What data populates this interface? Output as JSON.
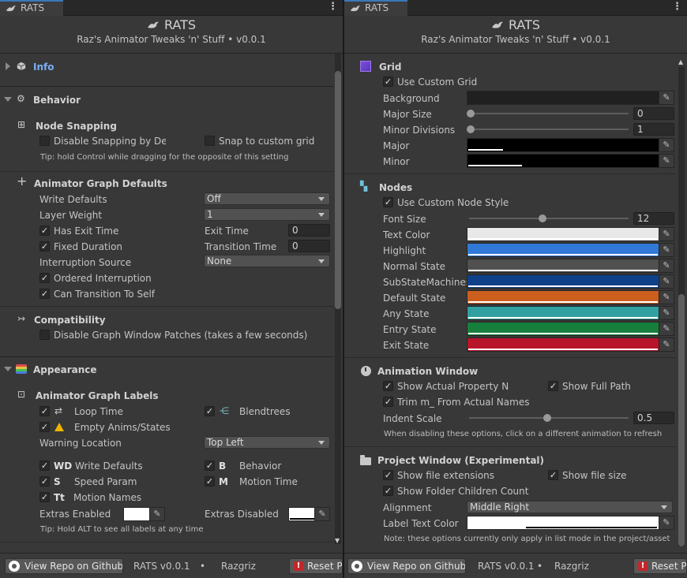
{
  "tab_label": "RATS",
  "header": {
    "title": "RATS",
    "subtitle": "Raz's Animator Tweaks 'n' Stuff  •  v0.0.1"
  },
  "left": {
    "info_label": "Info",
    "behavior_label": "Behavior",
    "node_snapping": {
      "title": "Node Snapping",
      "disable_snapping": "Disable Snapping by Defa",
      "snap_custom_grid": "Snap to custom grid",
      "tip": "Tip: hold Control while dragging for the opposite of this setting"
    },
    "defaults": {
      "title": "Animator Graph Defaults",
      "write_defaults_label": "Write Defaults",
      "write_defaults_value": "Off",
      "layer_weight_label": "Layer Weight",
      "layer_weight_value": "1",
      "has_exit_time": "Has Exit Time",
      "exit_time_label": "Exit Time",
      "exit_time_value": "0",
      "fixed_duration": "Fixed Duration",
      "transition_time_label": "Transition Time",
      "transition_time_value": "0",
      "interruption_source_label": "Interruption Source",
      "interruption_source_value": "None",
      "ordered_interruption": "Ordered Interruption",
      "can_transition_to_self": "Can Transition To Self"
    },
    "compatibility": {
      "title": "Compatibility",
      "disable_patches": "Disable Graph Window Patches (takes a few seconds)"
    },
    "appearance_label": "Appearance",
    "labels": {
      "title": "Animator Graph Labels",
      "loop_time": "Loop Time",
      "blendtrees": "Blendtrees",
      "empty_anims": "Empty Anims/States",
      "warning_location_label": "Warning Location",
      "warning_location_value": "Top Left",
      "wd_tag": "WD",
      "wd_label": "Write Defaults",
      "b_tag": "B",
      "b_label": "Behavior",
      "s_tag": "S",
      "s_label": "Speed Param",
      "m_tag": "M",
      "m_label": "Motion Time",
      "tt_tag": "Tt",
      "tt_label": "Motion Names",
      "extras_enabled_label": "Extras Enabled",
      "extras_disabled_label": "Extras Disabled",
      "tip": "Tip: Hold ALT to see all labels at any time"
    }
  },
  "right": {
    "grid": {
      "title": "Grid",
      "use_custom_grid": "Use Custom Grid",
      "background_label": "Background",
      "major_size_label": "Major Size",
      "major_size_value": "0",
      "minor_divisions_label": "Minor Divisions",
      "minor_divisions_value": "1",
      "major_label": "Major",
      "minor_label": "Minor"
    },
    "nodes": {
      "title": "Nodes",
      "use_custom_node_style": "Use Custom Node Style",
      "font_size_label": "Font Size",
      "font_size_value": "12",
      "text_color_label": "Text Color",
      "highlight_label": "Highlight",
      "normal_state_label": "Normal State",
      "substate_label": "SubStateMachines",
      "default_state_label": "Default State",
      "any_state_label": "Any State",
      "entry_state_label": "Entry State",
      "exit_state_label": "Exit State"
    },
    "animation_window": {
      "title": "Animation Window",
      "show_actual_property": "Show Actual Property Na",
      "show_full_path": "Show Full Path",
      "trim_m": "Trim m_ From Actual Names",
      "indent_scale_label": "Indent Scale",
      "indent_scale_value": "0.5",
      "note": "When disabling these options, click on a different animation to refresh"
    },
    "project_window": {
      "title": "Project Window (Experimental)",
      "show_file_extensions": "Show file extensions",
      "show_file_size": "Show file size",
      "show_folder_children": "Show Folder Children Count",
      "alignment_label": "Alignment",
      "alignment_value": "Middle Right",
      "label_text_color_label": "Label Text Color",
      "note": "Note: these options currently only apply in list mode in the project/asset sel"
    }
  },
  "footer": {
    "github_button": "View Repo on Github",
    "version": "RATS  v0.0.1",
    "bullet": "•",
    "author": "Razgriz",
    "reset_button": "Reset P"
  },
  "checkmark": "✓",
  "icon_names": [
    "bird-icon",
    "info-cube-icon",
    "gear-icon",
    "snap-icon",
    "plus-icon",
    "compat-arrow-icon",
    "appearance-icon",
    "labels-icon",
    "loop-icon",
    "blendtree-icon",
    "warning-icon",
    "grid-icon",
    "nodes-icon",
    "clock-icon",
    "folder-icon",
    "eyedropper-icon",
    "github-icon",
    "reset-icon"
  ],
  "colors": {
    "accent": "#3a79bb",
    "info_link": "#7ab0f5",
    "text_color": "#e8e8e8",
    "highlight": "#3179d6",
    "normal_state": "#505050",
    "substate": "#0f4189",
    "default_state": "#cd5f1e",
    "any_state": "#32a0a0",
    "entry_state": "#177f3c",
    "exit_state": "#b8142a"
  }
}
